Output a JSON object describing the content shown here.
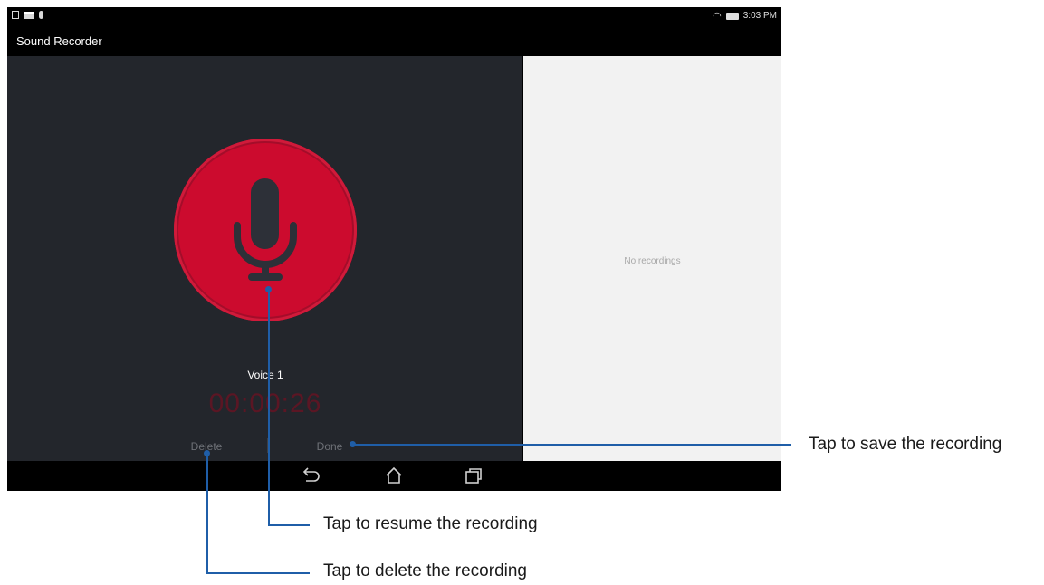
{
  "status_bar": {
    "time": "3:03 PM",
    "left_icons": [
      "notification-icon",
      "sd-card-icon",
      "mic-status-icon"
    ],
    "right_icons": [
      "wifi-icon",
      "battery-icon"
    ]
  },
  "app": {
    "title": "Sound Recorder"
  },
  "recorder": {
    "recording_name": "Voice 1",
    "timer": "00:00:26",
    "delete_label": "Delete",
    "done_label": "Done",
    "record_button_icon": "microphone-icon",
    "record_button_color": "#cc0b2e",
    "panel_color": "#23262c"
  },
  "recordings_list": {
    "empty_text": "No recordings"
  },
  "nav_bar": {
    "buttons": [
      "back-icon",
      "home-icon",
      "recent-apps-icon"
    ]
  },
  "annotations": {
    "save": "Tap to save the recording",
    "resume": "Tap to resume the recording",
    "delete": "Tap to delete the recording",
    "line_color": "#1f5ea8"
  }
}
